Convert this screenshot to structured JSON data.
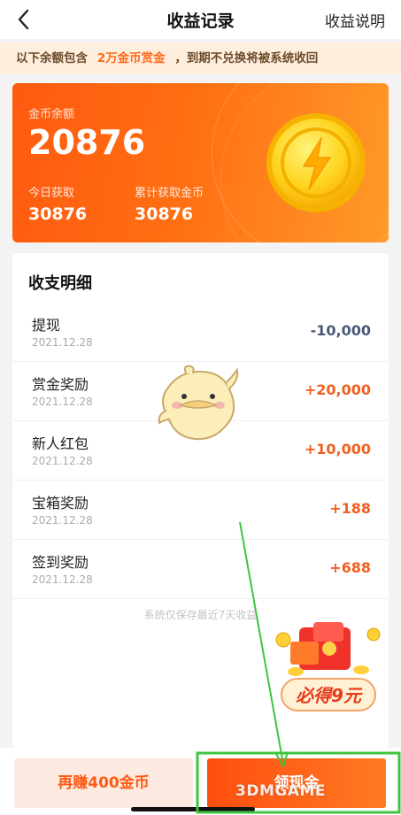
{
  "header": {
    "title": "收益记录",
    "help_label": "收益说明"
  },
  "notice": {
    "prefix": "以下余额包含",
    "highlight": "2万金币赏金",
    "suffix": "，到期不兑换将被系统收回"
  },
  "balance": {
    "label": "金币余额",
    "value": "20876",
    "today_label": "今日获取",
    "today_value": "30876",
    "total_label": "累计获取金币",
    "total_value": "30876"
  },
  "details": {
    "title": "收支明细",
    "items": [
      {
        "name": "提现",
        "date": "2021.12.28",
        "amount": "-10,000"
      },
      {
        "name": "赏金奖励",
        "date": "2021.12.28",
        "amount": "+20,000"
      },
      {
        "name": "新人红包",
        "date": "2021.12.28",
        "amount": "+10,000"
      },
      {
        "name": "宝箱奖励",
        "date": "2021.12.28",
        "amount": "+188"
      },
      {
        "name": "签到奖励",
        "date": "2021.12.28",
        "amount": "+688"
      }
    ],
    "footer": "系统仅保存最近7天收益"
  },
  "promo": {
    "text": "必得9元"
  },
  "bottom": {
    "earn_label": "再赚400金币",
    "withdraw_label": "领现金"
  },
  "watermark": "3DMGAME",
  "colors": {
    "accent": "#ff5a10",
    "positive": "#f06021",
    "negative": "#4b5a77",
    "annotation": "#3ec43e"
  }
}
